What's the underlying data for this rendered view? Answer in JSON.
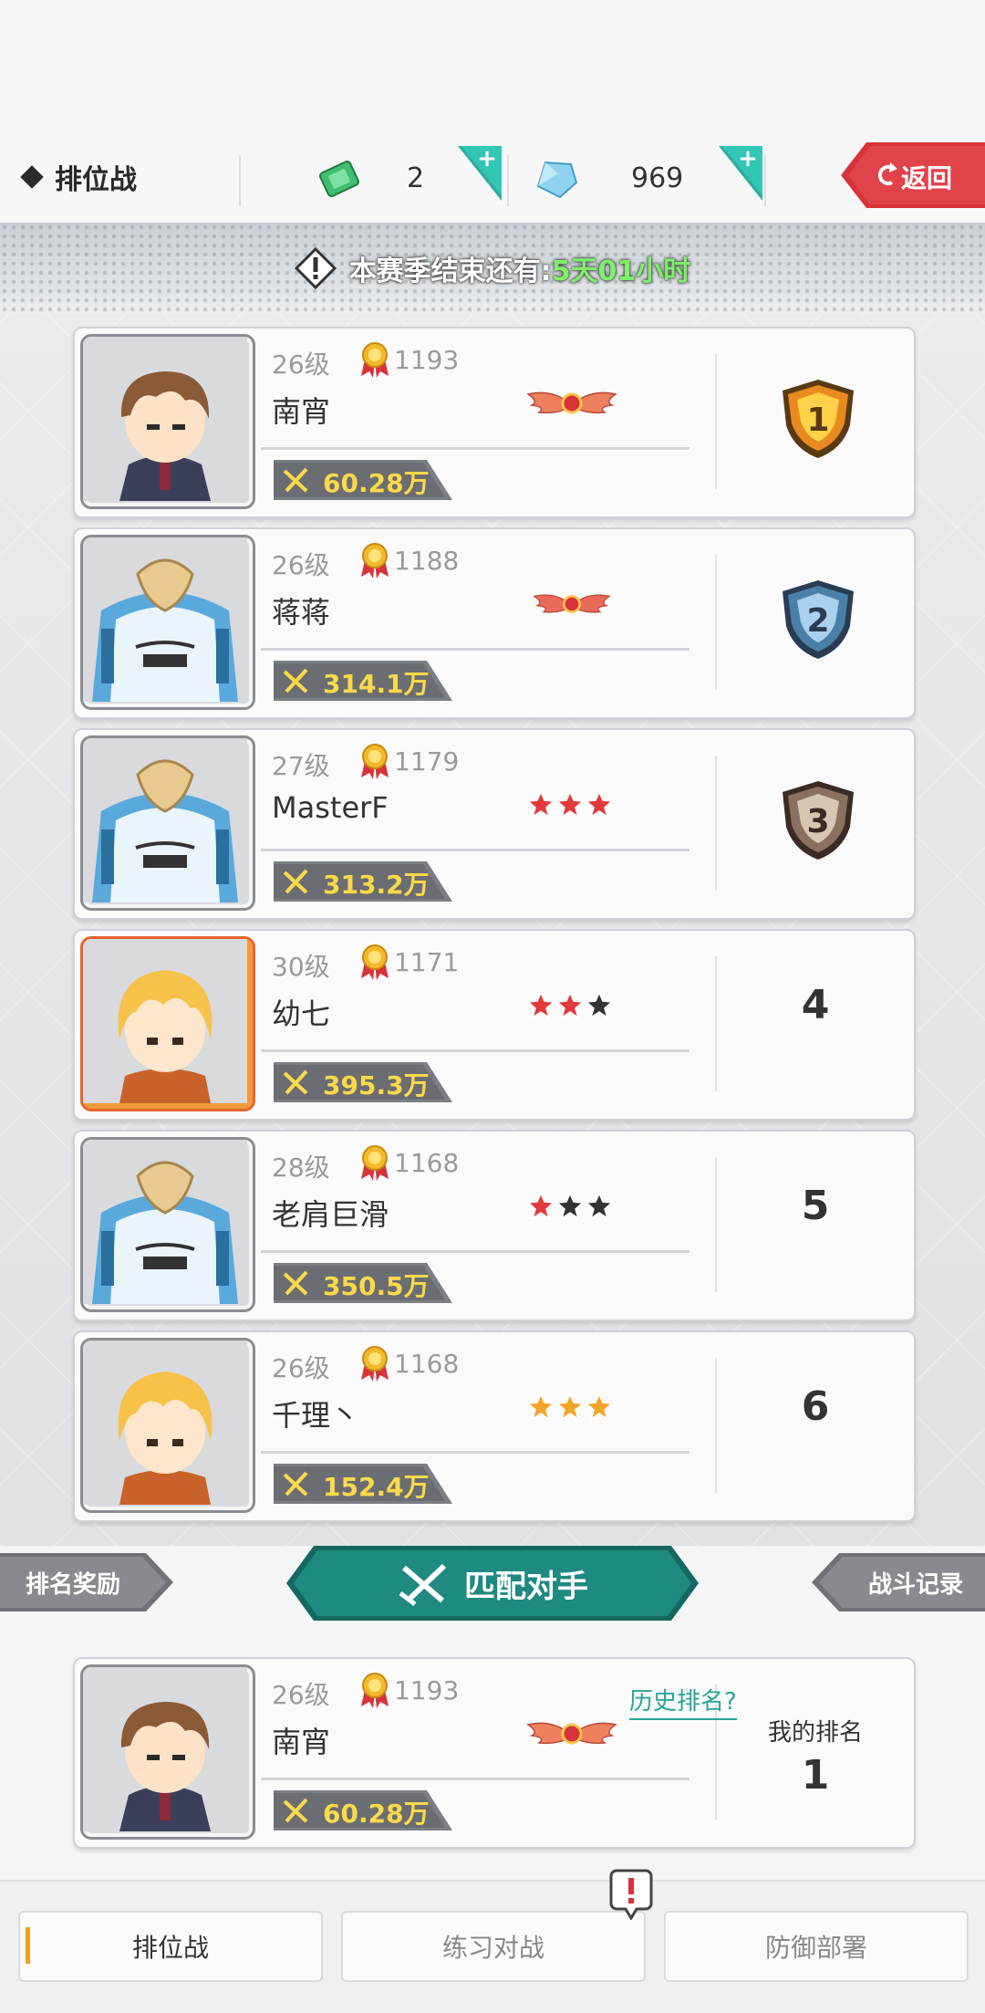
{
  "header": {
    "title": "排位战",
    "tickets": "2",
    "gems": "969",
    "back_label": "返回"
  },
  "season": {
    "prefix": "本赛季结束还有:",
    "time": "5天01小时"
  },
  "players": [
    {
      "level": "26级",
      "score": "1193",
      "name": "南宵",
      "power": "60.28万",
      "rank_badge": "gold-wings",
      "rank": "1",
      "rank_style": "gold-shield",
      "stars_filled": 0
    },
    {
      "level": "26级",
      "score": "1188",
      "name": "蒋蒋",
      "power": "314.1万",
      "rank_badge": "silver-wings",
      "rank": "2",
      "rank_style": "blue-shield",
      "stars_filled": 0
    },
    {
      "level": "27级",
      "score": "1179",
      "name": "MasterF",
      "power": "313.2万",
      "rank_badge": "stars",
      "rank": "3",
      "rank_style": "bronze-shield",
      "stars_filled": 3
    },
    {
      "level": "30级",
      "score": "1171",
      "name": "幼七",
      "power": "395.3万",
      "rank_badge": "stars",
      "rank": "4",
      "rank_style": "number",
      "stars_filled": 2
    },
    {
      "level": "28级",
      "score": "1168",
      "name": "老肩巨滑",
      "power": "350.5万",
      "rank_badge": "stars",
      "rank": "5",
      "rank_style": "number",
      "stars_filled": 1
    },
    {
      "level": "26级",
      "score": "1168",
      "name": "千理丶",
      "power": "152.4万",
      "rank_badge": "gold-stars",
      "rank": "6",
      "rank_style": "number",
      "stars_filled": 3
    }
  ],
  "actions": {
    "rank_rewards": "排名奖励",
    "match": "匹配对手",
    "battle_log": "战斗记录"
  },
  "me": {
    "level": "26级",
    "score": "1193",
    "name": "南宵",
    "power": "60.28万",
    "history_link": "历史排名?",
    "my_rank_label": "我的排名",
    "my_rank": "1"
  },
  "tabs": [
    "排位战",
    "练习对战",
    "防御部署"
  ],
  "colors": {
    "accent_teal": "#1e8a80",
    "back_red": "#d8323a",
    "power_yellow": "#ffd94a",
    "timer_green": "#7ef06a"
  }
}
